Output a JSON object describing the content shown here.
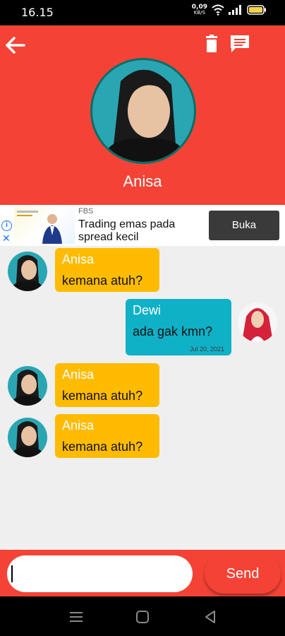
{
  "status_bar": {
    "time": "16.15",
    "net_speed_value": "0,09",
    "net_speed_unit": "KB/S"
  },
  "header": {
    "contact_name": "Anisa"
  },
  "ad": {
    "source": "FBS",
    "title": "Trading emas pada spread kecil",
    "cta_label": "Buka",
    "info_icon": "info-icon",
    "close_icon": "close-icon"
  },
  "messages": [
    {
      "direction": "incoming",
      "sender": "Anisa",
      "text": "kemana atuh?"
    },
    {
      "direction": "outgoing",
      "sender": "Dewi",
      "text": "ada gak kmn?",
      "time": "Jul 20, 2021"
    },
    {
      "direction": "incoming",
      "sender": "Anisa",
      "text": "kemana atuh?"
    },
    {
      "direction": "incoming",
      "sender": "Anisa",
      "text": "kemana atuh?"
    }
  ],
  "composer": {
    "placeholder": "",
    "value": "",
    "send_label": "Send"
  },
  "colors": {
    "primary": "#f44336",
    "incoming_bubble": "#ffbb00",
    "outgoing_bubble": "#0fb1c7",
    "background": "#efefef"
  },
  "icons": [
    "back-arrow-icon",
    "trash-icon",
    "chat-icon",
    "wifi-icon",
    "signal-icon",
    "battery-icon"
  ]
}
